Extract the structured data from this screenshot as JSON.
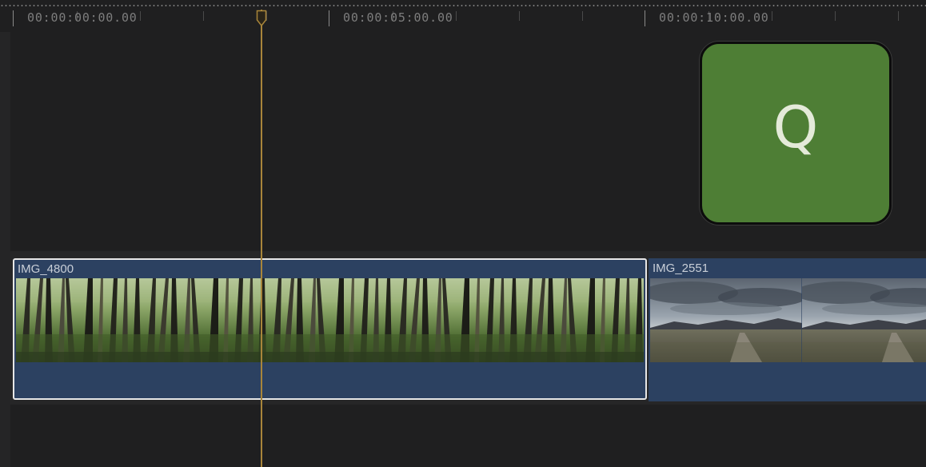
{
  "ruler": {
    "timecodes": [
      "00:00:00:00.00",
      "00:00:05:00.00",
      "00:00:10:00.00"
    ]
  },
  "clips": [
    {
      "name": "IMG_4800",
      "selected": true,
      "thumbnail": "forest"
    },
    {
      "name": "IMG_2551",
      "selected": false,
      "thumbnail": "cloudy-landscape"
    }
  ],
  "key_overlay": {
    "label": "Q",
    "color": "#4e7e35"
  },
  "colors": {
    "background": "#1f1f20",
    "clip": "#2c4161",
    "playhead": "#a8853a",
    "selection": "#e6e6e6"
  }
}
